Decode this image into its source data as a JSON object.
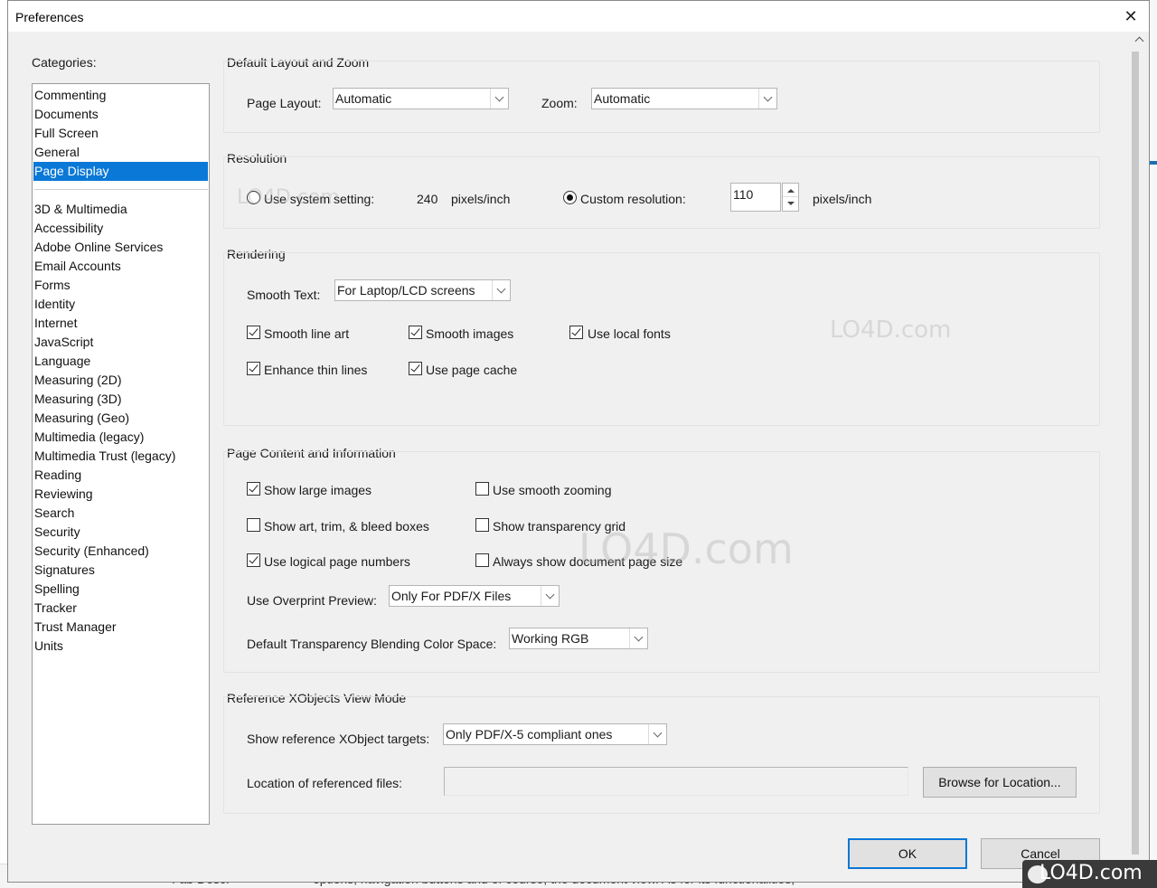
{
  "window": {
    "title": "Preferences",
    "close_glyph": "✕"
  },
  "categories": {
    "heading": "Categories:",
    "primary": [
      "Commenting",
      "Documents",
      "Full Screen",
      "General",
      "Page Display"
    ],
    "secondary": [
      "3D & Multimedia",
      "Accessibility",
      "Adobe Online Services",
      "Email Accounts",
      "Forms",
      "Identity",
      "Internet",
      "JavaScript",
      "Language",
      "Measuring (2D)",
      "Measuring (3D)",
      "Measuring (Geo)",
      "Multimedia (legacy)",
      "Multimedia Trust (legacy)",
      "Reading",
      "Reviewing",
      "Search",
      "Security",
      "Security (Enhanced)",
      "Signatures",
      "Spelling",
      "Tracker",
      "Trust Manager",
      "Units"
    ],
    "selected": "Page Display"
  },
  "layout_zoom": {
    "title": "Default Layout and Zoom",
    "page_layout_label": "Page Layout:",
    "page_layout_value": "Automatic",
    "zoom_label": "Zoom:",
    "zoom_value": "Automatic"
  },
  "resolution": {
    "title": "Resolution",
    "system_label": "Use system setting:",
    "system_value": "240",
    "system_unit": "pixels/inch",
    "custom_label": "Custom resolution:",
    "custom_value": "110",
    "custom_unit": "pixels/inch",
    "selected": "custom"
  },
  "rendering": {
    "title": "Rendering",
    "smooth_text_label": "Smooth Text:",
    "smooth_text_value": "For Laptop/LCD screens",
    "smooth_line_art": "Smooth line art",
    "smooth_images": "Smooth images",
    "use_local_fonts": "Use local fonts",
    "enhance_thin_lines": "Enhance thin lines",
    "use_page_cache": "Use page cache"
  },
  "page_content": {
    "title": "Page Content and Information",
    "show_large_images": "Show large images",
    "use_smooth_zooming": "Use smooth zooming",
    "show_art_trim": "Show art, trim, & bleed boxes",
    "show_transparency_grid": "Show transparency grid",
    "use_logical_page_numbers": "Use logical page numbers",
    "always_show_doc_size": "Always show document page size",
    "overprint_label": "Use Overprint Preview:",
    "overprint_value": "Only For PDF/X Files",
    "blending_label": "Default Transparency Blending Color Space:",
    "blending_value": "Working RGB"
  },
  "xobjects": {
    "title": "Reference XObjects View Mode",
    "targets_label": "Show reference XObject targets:",
    "targets_value": "Only PDF/X-5 compliant ones",
    "location_label": "Location of referenced files:",
    "location_value": "",
    "browse_button": "Browse for Location..."
  },
  "buttons": {
    "ok": "OK",
    "cancel": "Cancel"
  },
  "background": {
    "bottom_left": "Fab Desc.",
    "bottom_mid": "options, navigation buttons and of course, the document view. As for its functionalities,"
  },
  "watermark": {
    "text": "LO4D.com"
  },
  "colors": {
    "accent": "#0a78d7"
  }
}
